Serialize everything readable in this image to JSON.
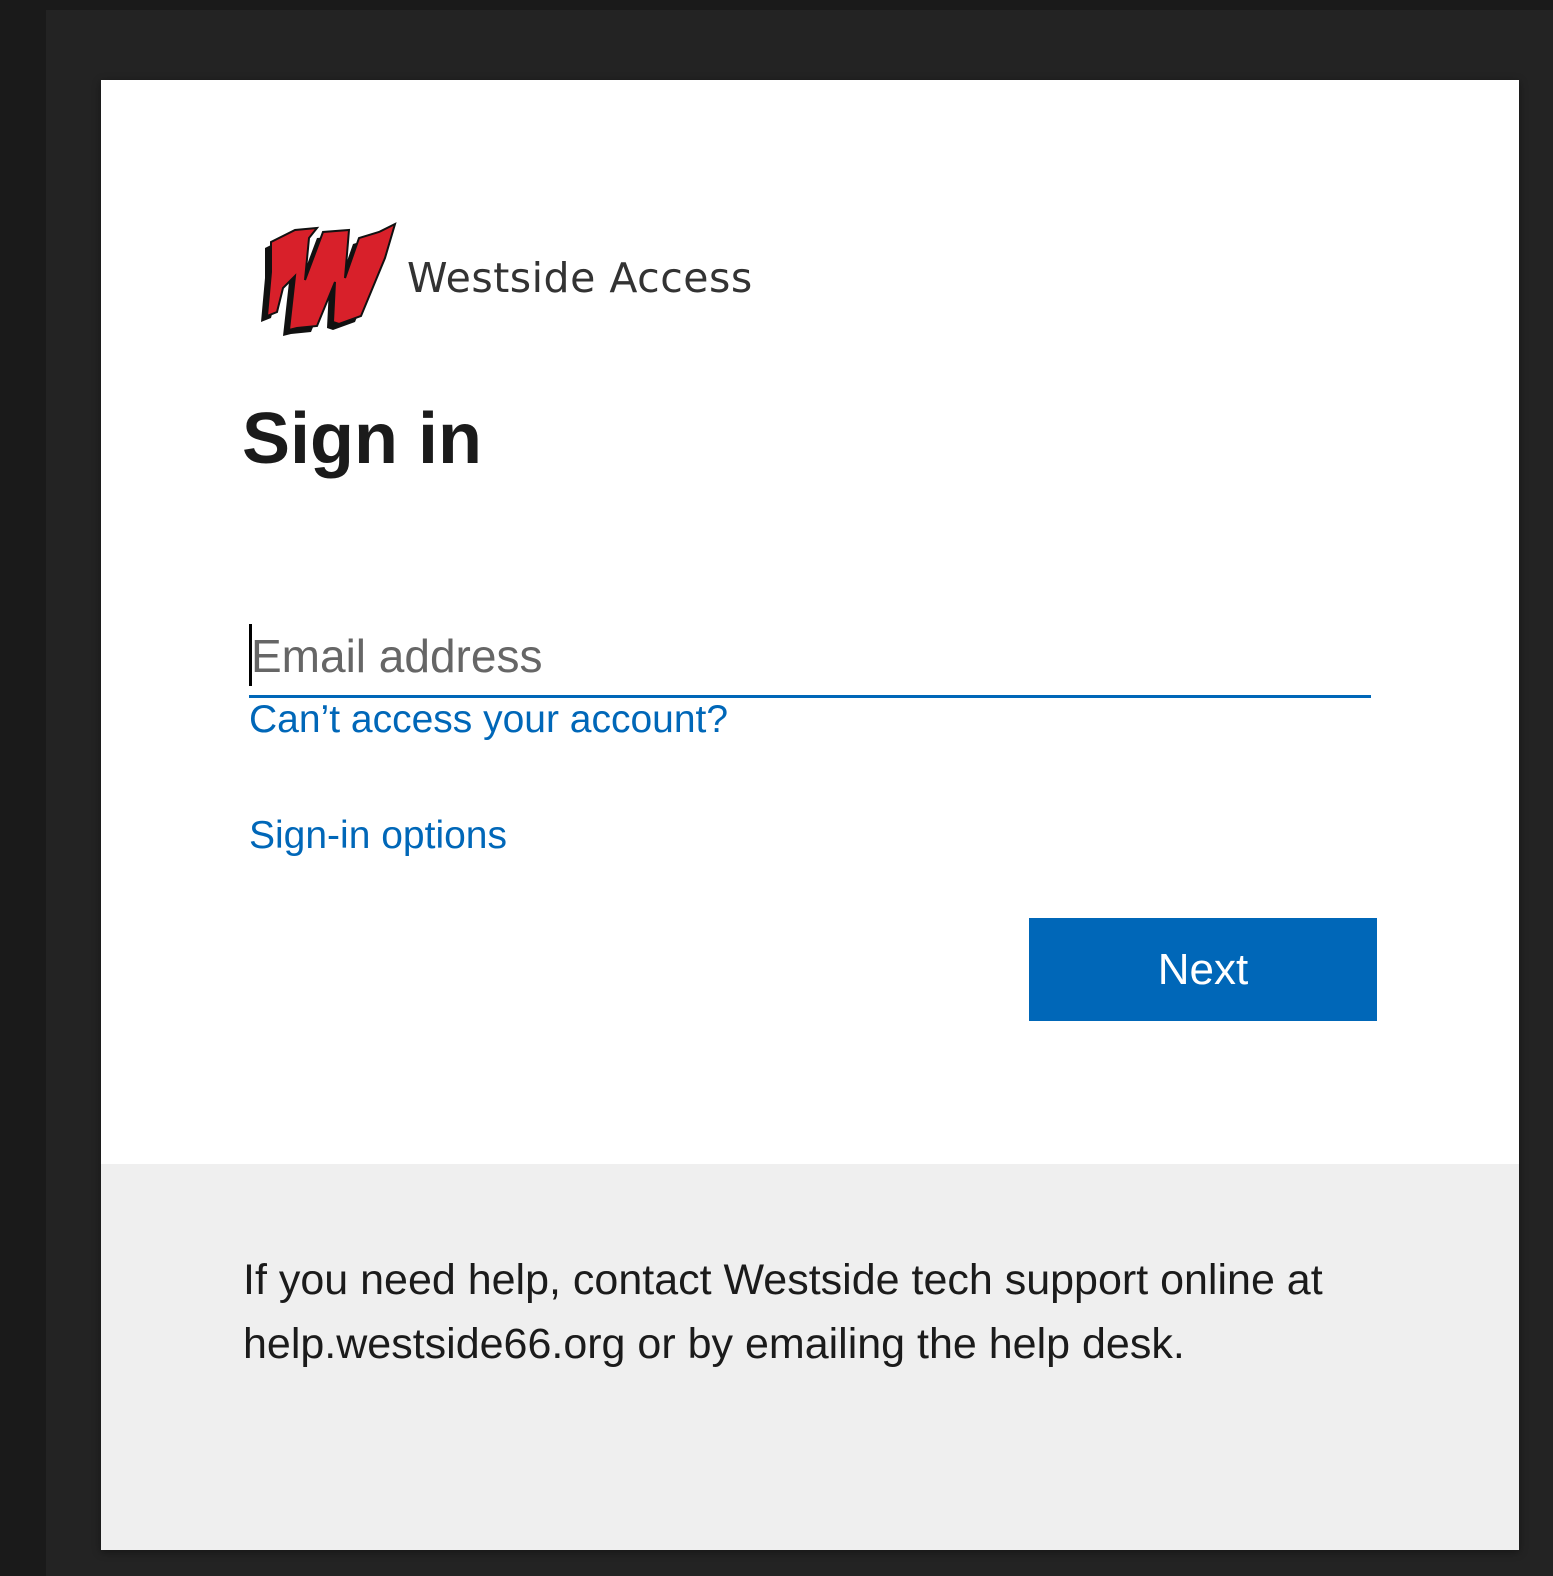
{
  "brand": {
    "name": "Westside Access",
    "logo_letter": "W",
    "logo_color": "#d8202a",
    "logo_shadow_color": "#111111"
  },
  "signin": {
    "title": "Sign in",
    "email_placeholder": "Email address",
    "email_value": "",
    "cant_access_link": "Can’t access your account?",
    "signin_options_link": "Sign-in options",
    "next_button": "Next"
  },
  "footer": {
    "help_text": "If you need help, contact Westside tech support online at help.westside66.org or by emailing the help desk."
  },
  "colors": {
    "accent": "#0067b8",
    "background": "#1a1a1a",
    "card": "#ffffff",
    "footer": "#efefef"
  }
}
